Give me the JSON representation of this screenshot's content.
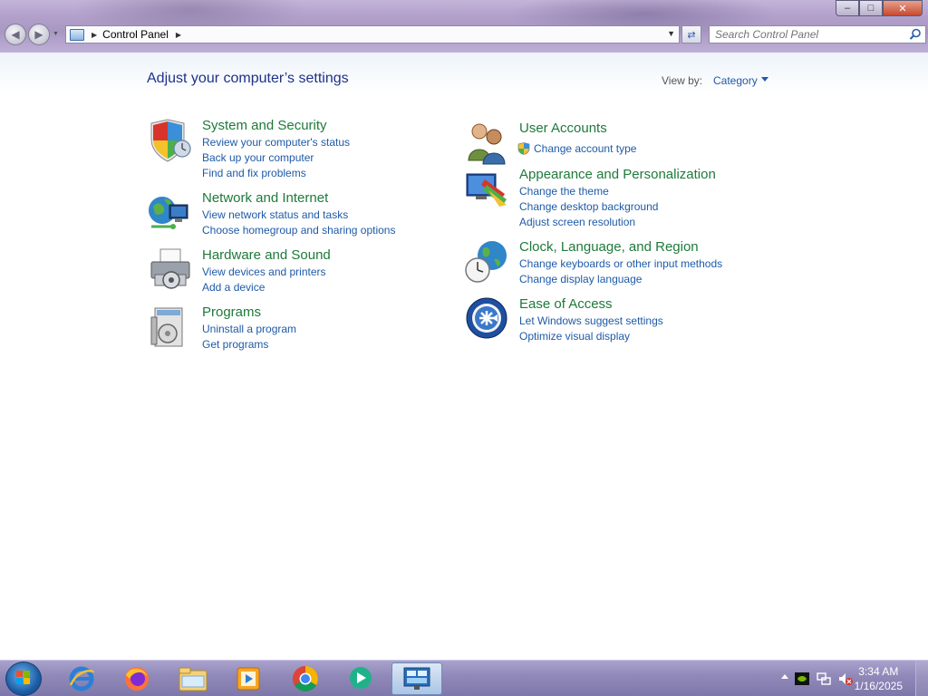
{
  "window": {
    "min_label": "–",
    "max_label": "□",
    "close_label": "✕"
  },
  "address": {
    "crumb": "Control Panel"
  },
  "search": {
    "placeholder": "Search Control Panel"
  },
  "page": {
    "title": "Adjust your computer’s settings",
    "view_by_label": "View by:",
    "view_by_value": "Category"
  },
  "categories": {
    "system_security": {
      "title": "System and Security",
      "links": [
        "Review your computer's status",
        "Back up your computer",
        "Find and fix problems"
      ]
    },
    "network_internet": {
      "title": "Network and Internet",
      "links": [
        "View network status and tasks",
        "Choose homegroup and sharing options"
      ]
    },
    "hardware_sound": {
      "title": "Hardware and Sound",
      "links": [
        "View devices and printers",
        "Add a device"
      ]
    },
    "programs": {
      "title": "Programs",
      "links": [
        "Uninstall a program",
        "Get programs"
      ]
    },
    "user_accounts": {
      "title": "User Accounts",
      "links": [
        "Change account type"
      ]
    },
    "appearance": {
      "title": "Appearance and Personalization",
      "links": [
        "Change the theme",
        "Change desktop background",
        "Adjust screen resolution"
      ]
    },
    "clock_region": {
      "title": "Clock, Language, and Region",
      "links": [
        "Change keyboards or other input methods",
        "Change display language"
      ]
    },
    "ease_access": {
      "title": "Ease of Access",
      "links": [
        "Let Windows suggest settings",
        "Optimize visual display"
      ]
    }
  },
  "taskbar": {
    "pinned": [
      "internet-explorer-icon",
      "firefox-icon",
      "file-explorer-icon",
      "media-player-icon",
      "chrome-icon",
      "media-app-icon",
      "control-panel-icon"
    ],
    "clock_time": "3:34 AM",
    "clock_date": "1/16/2025"
  },
  "colors": {
    "link": "#1e5aa8",
    "category_title": "#1e7a3a",
    "page_title": "#1e3287"
  }
}
